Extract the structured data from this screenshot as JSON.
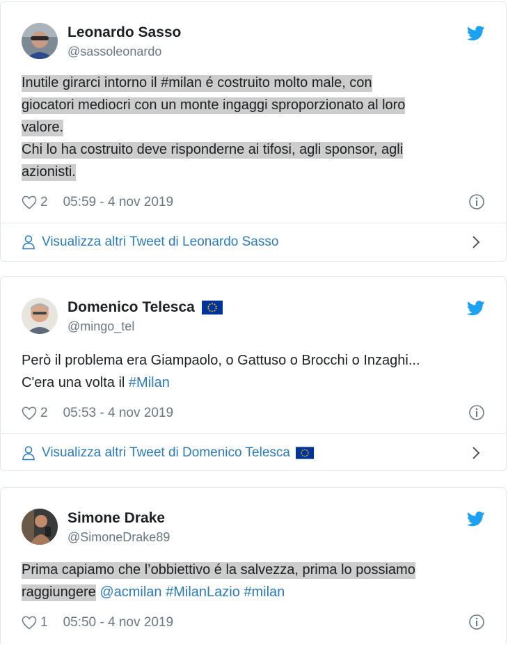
{
  "tweets": [
    {
      "name": "Leonardo Sasso",
      "handle": "@sassoleonardo",
      "text_lines": [
        "Inutile girarci intorno il #milan é costruito molto male, con",
        "giocatori mediocri con un monte ingaggi sproporzionato al loro",
        "valore.",
        "Chi lo ha costruito deve risponderne ai tifosi, agli sponsor, agli",
        "azionisti."
      ],
      "likes": "2",
      "timestamp": "05:59 - 4 nov 2019",
      "more_label": "Visualizza altri Tweet di Leonardo Sasso"
    },
    {
      "name": "Domenico Telesca",
      "handle": "@mingo_tel",
      "text_line1": "Però il problema era Giampaolo, o Gattuso o Brocchi o Inzaghi...",
      "text_line2_prefix": "C'era una volta il ",
      "hashtag": "#Milan",
      "likes": "2",
      "timestamp": "05:53 - 4 nov 2019",
      "more_label": "Visualizza altri Tweet di Domenico Telesca"
    },
    {
      "name": "Simone Drake",
      "handle": "@SimoneDrake89",
      "text_line1": "Prima capiamo che l’obbiettivo é la salvezza, prima lo possiamo",
      "text_line2_prefix": "raggiungere",
      "mentions": "@acmilan #MilanLazio #milan",
      "likes": "1",
      "timestamp": "05:50 - 4 nov 2019"
    }
  ],
  "icons": {
    "like": "heart-outline-icon",
    "info": "info-circle-icon",
    "brand": "twitter-bird-icon",
    "person": "person-outline-icon",
    "chevron": "chevron-right-icon",
    "flag": "eu-flag-icon"
  },
  "colors": {
    "link": "#2b7bb9",
    "text": "#1c2022",
    "muted": "#697882",
    "highlight": "#cdcdcd",
    "twitter_blue": "#1da1f2",
    "border": "#e1e8ed",
    "eu_blue": "#003399",
    "eu_gold": "#ffcc00"
  }
}
